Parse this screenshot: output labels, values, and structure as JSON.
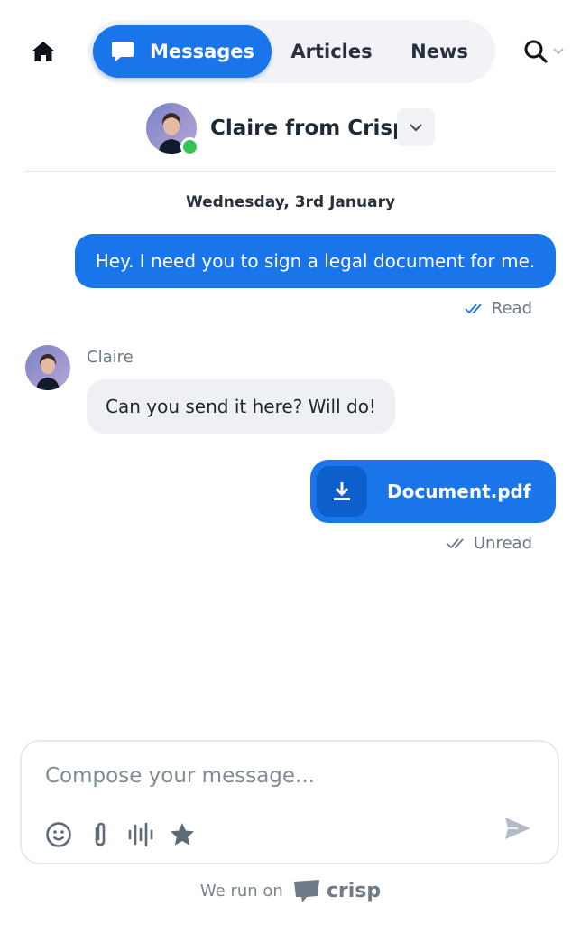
{
  "nav": {
    "tabs": [
      {
        "label": "Messages",
        "active": true
      },
      {
        "label": "Articles",
        "active": false
      },
      {
        "label": "News",
        "active": false
      }
    ]
  },
  "operator": {
    "name": "Claire from Crisp",
    "short_name": "Claire",
    "status": "online"
  },
  "conversation": {
    "date": "Wednesday, 3rd January",
    "messages": [
      {
        "from": "visitor",
        "text": "Hey. I need you to sign a legal document for me.",
        "status": "Read"
      },
      {
        "from": "operator",
        "text": "Can you send it here? Will do!"
      },
      {
        "from": "visitor",
        "file": "Document.pdf",
        "status": "Unread"
      }
    ]
  },
  "composer": {
    "placeholder": "Compose your message..."
  },
  "footer": {
    "text": "We run on",
    "brand": "crisp"
  },
  "colors": {
    "accent": "#1a74ea",
    "online": "#33c451",
    "bubble_in": "#eef0f3"
  }
}
